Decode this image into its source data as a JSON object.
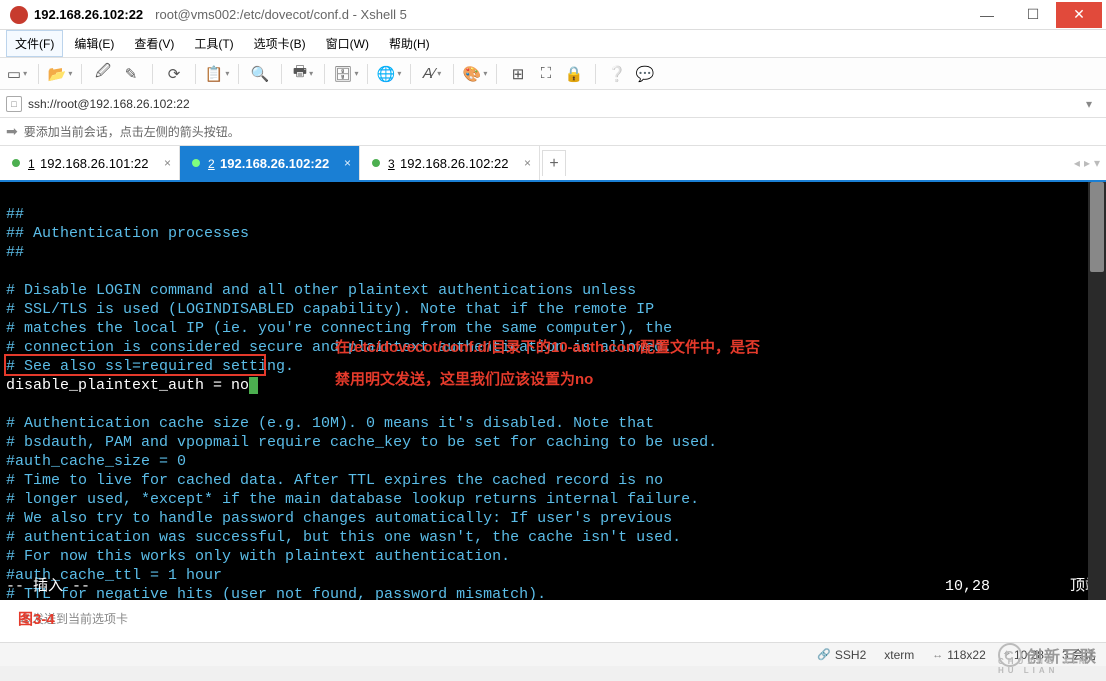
{
  "titlebar": {
    "host": "192.168.26.102:22",
    "path": "root@vms002:/etc/dovecot/conf.d - Xshell 5"
  },
  "menu": {
    "file": "文件(F)",
    "edit": "编辑(E)",
    "view": "查看(V)",
    "tools": "工具(T)",
    "tabs": "选项卡(B)",
    "window": "窗口(W)",
    "help": "帮助(H)"
  },
  "address": {
    "url": "ssh://root@192.168.26.102:22"
  },
  "infobar": {
    "text": "要添加当前会话，点击左侧的箭头按钮。"
  },
  "tabs": [
    {
      "num": "1",
      "label": "192.168.26.101:22",
      "active": false
    },
    {
      "num": "2",
      "label": "192.168.26.102:22",
      "active": true
    },
    {
      "num": "3",
      "label": "192.168.26.102:22",
      "active": false
    }
  ],
  "terminal": {
    "lines": [
      "##",
      "## Authentication processes",
      "##",
      "",
      "# Disable LOGIN command and all other plaintext authentications unless",
      "# SSL/TLS is used (LOGINDISABLED capability). Note that if the remote IP",
      "# matches the local IP (ie. you're connecting from the same computer), the",
      "# connection is considered secure and plaintext authentication is allowed.",
      "# See also ssl=required setting."
    ],
    "edit_line": "disable_plaintext_auth = no",
    "lines2": [
      "",
      "# Authentication cache size (e.g. 10M). 0 means it's disabled. Note that",
      "# bsdauth, PAM and vpopmail require cache_key to be set for caching to be used.",
      "#auth_cache_size = 0",
      "# Time to live for cached data. After TTL expires the cached record is no",
      "# longer used, *except* if the main database lookup returns internal failure.",
      "# We also try to handle password changes automatically: If user's previous",
      "# authentication was successful, but this one wasn't, the cache isn't used.",
      "# For now this works only with plaintext authentication.",
      "#auth_cache_ttl = 1 hour",
      "# TTL for negative hits (user not found, password mismatch)."
    ],
    "mode": "-- 插入 --",
    "pos": "10,28",
    "scroll": "顶端",
    "anno1": "在/etc/dovecot/conf.d/目录下的10-auth.conf配置文件中，是否",
    "anno2": "禁用明文发送，这里我们应该设置为no"
  },
  "bottom": {
    "hint": "本发送到当前选项卡",
    "fig": "图3-4"
  },
  "status": {
    "proto": "SSH2",
    "term": "xterm",
    "size": "118x22",
    "cursor": "10,28",
    "sessions": "3 会话"
  },
  "watermark": {
    "text": "创新互联",
    "sub": "CHUANG XIN HU LIAN"
  }
}
